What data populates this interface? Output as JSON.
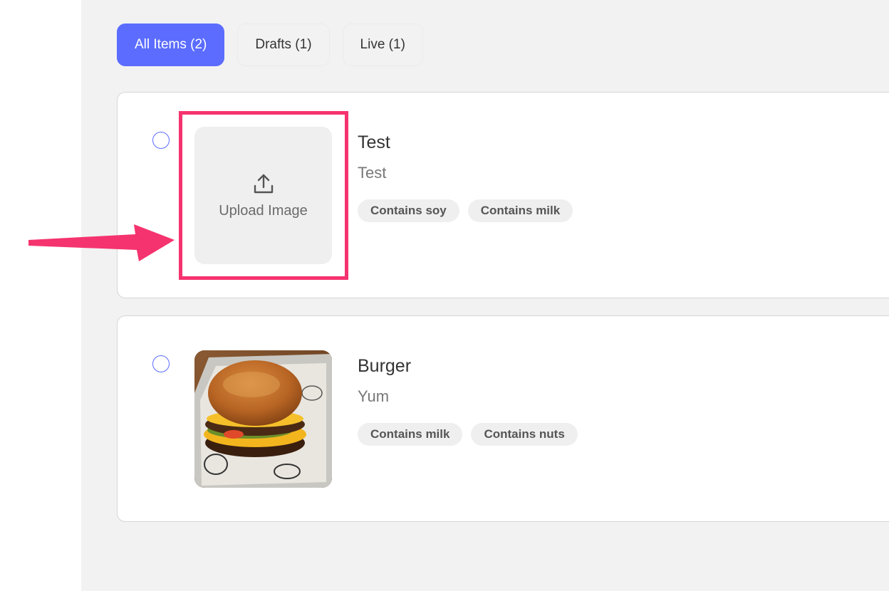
{
  "tabs": [
    {
      "label": "All Items (2)",
      "active": true
    },
    {
      "label": "Drafts (1)",
      "active": false
    },
    {
      "label": "Live (1)",
      "active": false
    }
  ],
  "items": [
    {
      "title": "Test",
      "description": "Test",
      "image": {
        "type": "upload-placeholder",
        "label": "Upload Image",
        "icon": "upload-icon"
      },
      "tags": [
        "Contains soy",
        "Contains milk"
      ]
    },
    {
      "title": "Burger",
      "description": "Yum",
      "image": {
        "type": "photo",
        "icon": "burger-photo"
      },
      "tags": [
        "Contains milk",
        "Contains nuts"
      ]
    }
  ],
  "colors": {
    "accent": "#5b6cff",
    "annotation": "#f5336e",
    "background": "#f2f2f2"
  }
}
